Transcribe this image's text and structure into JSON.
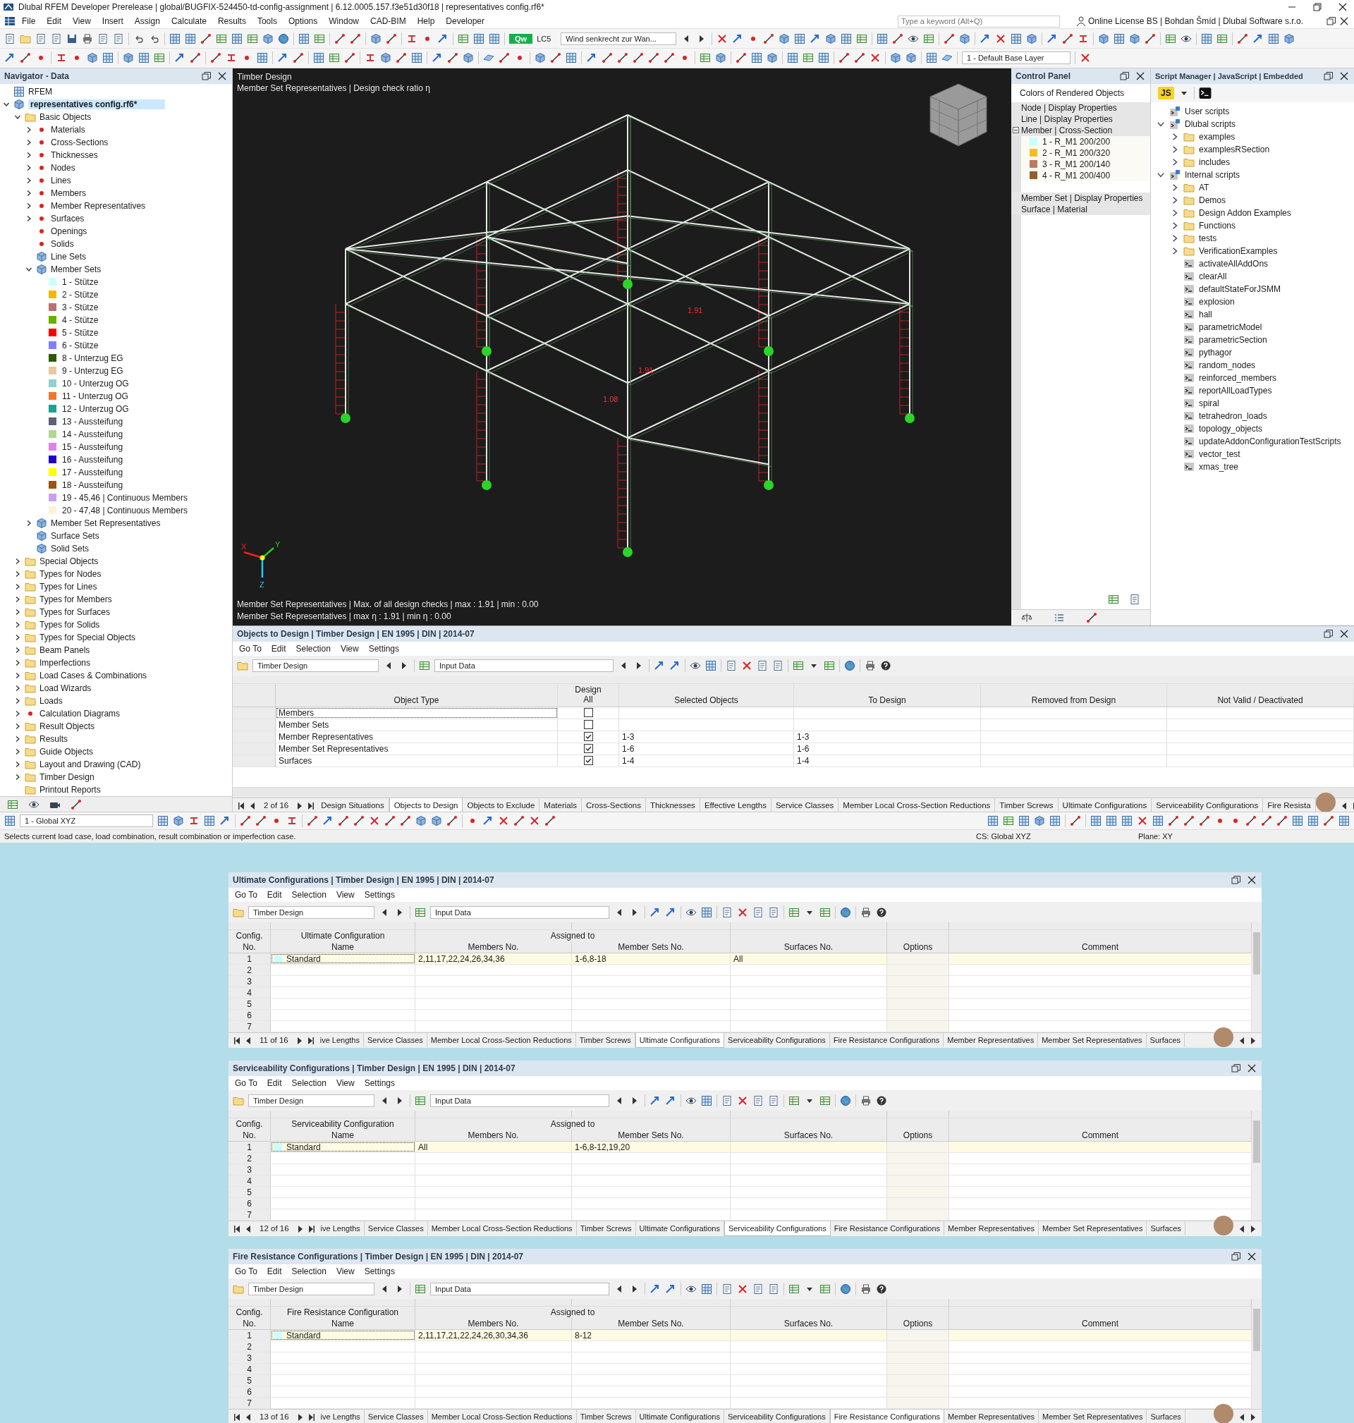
{
  "window": {
    "title": "Dlubal RFEM Developer Prerelease | global/BUGFIX-524450-td-config-assignment | 6.12.0005.157.f3e51d30f18 | representatives config.rf6*"
  },
  "menu": [
    "File",
    "Edit",
    "View",
    "Insert",
    "Assign",
    "Calculate",
    "Results",
    "Tools",
    "Options",
    "Window",
    "CAD-BIM",
    "Help",
    "Developer"
  ],
  "search": {
    "placeholder": "Type a keyword (Alt+Q)"
  },
  "license": "Online License BS | Bohdan Šmíd | Dlubal Software s.r.o.",
  "toolbar": {
    "load_badge": "Qw",
    "load_case": "LC5",
    "load_case_name": "Wind senkrecht zur Wan...",
    "layer": "1 - Default Base Layer"
  },
  "navigator": {
    "title": "Navigator - Data",
    "tree": [
      {
        "label": "RFEM",
        "kind": "root",
        "selected": false
      },
      {
        "label": "representatives config.rf6*",
        "kind": "file",
        "expanded": true,
        "selected": true,
        "children": [
          {
            "label": "Basic Objects",
            "kind": "folder",
            "expanded": true,
            "selected": false,
            "children": [
              {
                "label": "Materials",
                "kind": "object",
                "expanded": false,
                "selected": false
              },
              {
                "label": "Cross-Sections",
                "kind": "object",
                "expanded": false,
                "selected": false
              },
              {
                "label": "Thicknesses",
                "kind": "object",
                "expanded": false,
                "selected": false
              },
              {
                "label": "Nodes",
                "kind": "object",
                "expanded": false,
                "selected": false
              },
              {
                "label": "Lines",
                "kind": "object",
                "expanded": false,
                "selected": false
              },
              {
                "label": "Members",
                "kind": "object",
                "expanded": false,
                "selected": false
              },
              {
                "label": "Member Representatives",
                "kind": "object",
                "expanded": false,
                "selected": false
              },
              {
                "label": "Surfaces",
                "kind": "object",
                "expanded": false,
                "selected": false
              },
              {
                "label": "Openings",
                "kind": "object",
                "selected": false
              },
              {
                "label": "Solids",
                "kind": "object",
                "selected": false
              },
              {
                "label": "Line Sets",
                "kind": "object",
                "selected": false
              },
              {
                "label": "Member Sets",
                "kind": "object",
                "expanded": true,
                "selected": false,
                "children": [
                  {
                    "label": "1 - Stütze",
                    "kind": "set",
                    "color": "#ccffff",
                    "selected": false
                  },
                  {
                    "label": "2 - Stütze",
                    "kind": "set",
                    "color": "#f5b800",
                    "selected": false
                  },
                  {
                    "label": "3 - Stütze",
                    "kind": "set",
                    "color": "#b87070",
                    "selected": false
                  },
                  {
                    "label": "4 - Stütze",
                    "kind": "set",
                    "color": "#6ab000",
                    "selected": false
                  },
                  {
                    "label": "5 - Stütze",
                    "kind": "set",
                    "color": "#ff0000",
                    "selected": false
                  },
                  {
                    "label": "6 - Stütze",
                    "kind": "set",
                    "color": "#8080ff",
                    "selected": false
                  },
                  {
                    "label": "8 - Unterzug EG",
                    "kind": "set",
                    "color": "#2d5a00",
                    "selected": false
                  },
                  {
                    "label": "9 - Unterzug EG",
                    "kind": "set",
                    "color": "#e8c8a0",
                    "selected": false
                  },
                  {
                    "label": "10 - Unterzug OG",
                    "kind": "set",
                    "color": "#90d0d0",
                    "selected": false
                  },
                  {
                    "label": "11 - Unterzug OG",
                    "kind": "set",
                    "color": "#f07830",
                    "selected": false
                  },
                  {
                    "label": "12 - Unterzug OG",
                    "kind": "set",
                    "color": "#20a090",
                    "selected": false
                  },
                  {
                    "label": "13 - Aussteifung",
                    "kind": "set",
                    "color": "#606070",
                    "selected": false
                  },
                  {
                    "label": "14 - Aussteifung",
                    "kind": "set",
                    "color": "#b0d890",
                    "selected": false
                  },
                  {
                    "label": "15 - Aussteifung",
                    "kind": "set",
                    "color": "#e080f0",
                    "selected": false
                  },
                  {
                    "label": "16 - Aussteifung",
                    "kind": "set",
                    "color": "#2000c0",
                    "selected": false
                  },
                  {
                    "label": "17 - Aussteifung",
                    "kind": "set",
                    "color": "#ffff00",
                    "selected": false
                  },
                  {
                    "label": "18 - Aussteifung",
                    "kind": "set",
                    "color": "#a05010",
                    "selected": false
                  },
                  {
                    "label": "19 - 45,46 | Continuous Members",
                    "kind": "set",
                    "color": "#c8a0f0",
                    "selected": false
                  },
                  {
                    "label": "20 - 47,48 | Continuous Members",
                    "kind": "set",
                    "color": "#fff0d8",
                    "selected": false
                  }
                ]
              },
              {
                "label": "Member Set Representatives",
                "kind": "object",
                "expanded": false,
                "selected": false
              },
              {
                "label": "Surface Sets",
                "kind": "object",
                "selected": false
              },
              {
                "label": "Solid Sets",
                "kind": "object",
                "selected": false
              }
            ]
          },
          {
            "label": "Special Objects",
            "kind": "folder",
            "expanded": false,
            "selected": false
          },
          {
            "label": "Types for Nodes",
            "kind": "folder",
            "expanded": false,
            "selected": false
          },
          {
            "label": "Types for Lines",
            "kind": "folder",
            "expanded": false,
            "selected": false
          },
          {
            "label": "Types for Members",
            "kind": "folder",
            "expanded": false,
            "selected": false
          },
          {
            "label": "Types for Surfaces",
            "kind": "folder",
            "expanded": false,
            "selected": false
          },
          {
            "label": "Types for Solids",
            "kind": "folder",
            "expanded": false,
            "selected": false
          },
          {
            "label": "Types for Special Objects",
            "kind": "folder",
            "expanded": false,
            "selected": false
          },
          {
            "label": "Beam Panels",
            "kind": "folder",
            "expanded": false,
            "selected": false
          },
          {
            "label": "Imperfections",
            "kind": "folder",
            "expanded": false,
            "selected": false
          },
          {
            "label": "Load Cases & Combinations",
            "kind": "folder",
            "expanded": false,
            "selected": false
          },
          {
            "label": "Load Wizards",
            "kind": "folder",
            "expanded": false,
            "selected": false
          },
          {
            "label": "Loads",
            "kind": "folder",
            "expanded": false,
            "selected": false
          },
          {
            "label": "Calculation Diagrams",
            "kind": "object",
            "expanded": false,
            "selected": false
          },
          {
            "label": "Result Objects",
            "kind": "folder",
            "expanded": false,
            "selected": false
          },
          {
            "label": "Results",
            "kind": "folder",
            "expanded": false,
            "selected": false
          },
          {
            "label": "Guide Objects",
            "kind": "folder",
            "expanded": false,
            "selected": false
          },
          {
            "label": "Layout and Drawing (CAD)",
            "kind": "folder",
            "expanded": false,
            "selected": false
          },
          {
            "label": "Timber Design",
            "kind": "folder",
            "expanded": false,
            "selected": false
          },
          {
            "label": "Printout Reports",
            "kind": "folder",
            "selected": false
          }
        ]
      }
    ]
  },
  "viewport": {
    "title": "Timber Design",
    "subtitle": "Member Set Representatives | Design check ratio η",
    "labels": [
      "1.91",
      "1.91",
      "1.08"
    ],
    "axes": [
      "X",
      "Y",
      "Z"
    ],
    "footer": [
      "Member Set Representatives | Max. of all design checks | max  : 1.91 | min  : 0.00",
      "Member Set Representatives | max η : 1.91 | min η : 0.00"
    ]
  },
  "control_panel": {
    "title": "Control Panel",
    "heading": "Colors of Rendered Objects",
    "groups": [
      {
        "label": "Node | Display Properties"
      },
      {
        "label": "Line | Display Properties"
      },
      {
        "label": "Member | Cross-Section",
        "expanded": true,
        "items": [
          {
            "label": "1 - R_M1 200/200",
            "color": "#c8ffff"
          },
          {
            "label": "2 - R_M1 200/320",
            "color": "#f0c020"
          },
          {
            "label": "3 - R_M1 200/140",
            "color": "#c07860"
          },
          {
            "label": "4 - R_M1 200/400",
            "color": "#906030"
          }
        ]
      },
      {
        "label": "Member Set | Display Properties"
      },
      {
        "label": "Surface | Material"
      }
    ]
  },
  "script_manager": {
    "title": "Script Manager | JavaScript | Embedded",
    "language": "JS",
    "tree": [
      {
        "label": "User scripts",
        "kind": "root"
      },
      {
        "label": "Dlubal scripts",
        "kind": "root",
        "expanded": true,
        "children": [
          {
            "label": "examples",
            "kind": "folder",
            "expanded": false
          },
          {
            "label": "examplesRSection",
            "kind": "folder",
            "expanded": false
          },
          {
            "label": "includes",
            "kind": "folder",
            "expanded": false
          }
        ]
      },
      {
        "label": "Internal scripts",
        "kind": "root",
        "expanded": true,
        "children": [
          {
            "label": "AT",
            "kind": "folder",
            "expanded": false
          },
          {
            "label": "Demos",
            "kind": "folder",
            "expanded": false
          },
          {
            "label": "Design Addon Examples",
            "kind": "folder",
            "expanded": false
          },
          {
            "label": "Functions",
            "kind": "folder",
            "expanded": false
          },
          {
            "label": "tests",
            "kind": "folder",
            "expanded": false
          },
          {
            "label": "VerificationExamples",
            "kind": "folder",
            "expanded": false
          },
          {
            "label": "activateAllAddOns",
            "kind": "script"
          },
          {
            "label": "clearAll",
            "kind": "script"
          },
          {
            "label": "defaultStateForJSMM",
            "kind": "script"
          },
          {
            "label": "explosion",
            "kind": "script"
          },
          {
            "label": "hall",
            "kind": "script"
          },
          {
            "label": "parametricModel",
            "kind": "script"
          },
          {
            "label": "parametricSection",
            "kind": "script"
          },
          {
            "label": "pythagor",
            "kind": "script"
          },
          {
            "label": "random_nodes",
            "kind": "script"
          },
          {
            "label": "reinforced_members",
            "kind": "script"
          },
          {
            "label": "reportAllLoadTypes",
            "kind": "script"
          },
          {
            "label": "spiral",
            "kind": "script"
          },
          {
            "label": "tetrahedron_loads",
            "kind": "script"
          },
          {
            "label": "topology_objects",
            "kind": "script"
          },
          {
            "label": "updateAddonConfigurationTestScripts",
            "kind": "script"
          },
          {
            "label": "vector_test",
            "kind": "script"
          },
          {
            "label": "xmas_tree",
            "kind": "script"
          }
        ]
      }
    ]
  },
  "objects_panel": {
    "title": "Objects to Design | Timber Design | EN 1995 | DIN | 2014-07",
    "menu": [
      "Go To",
      "Edit",
      "Selection",
      "View",
      "Settings"
    ],
    "module": "Timber Design",
    "data_view": "Input Data",
    "columns": [
      "Object Type",
      "Design",
      "All",
      "Selected Objects",
      "To Design",
      "Removed from Design",
      "Not Valid / Deactivated"
    ],
    "rows": [
      {
        "object_type": "Members",
        "design": false,
        "selected": true
      },
      {
        "object_type": "Member Sets",
        "design": false,
        "selected": false
      },
      {
        "object_type": "Member Representatives",
        "design": true,
        "selected_objects": "1-3",
        "to_design": "1-3",
        "selected": false
      },
      {
        "object_type": "Member Set Representatives",
        "design": true,
        "selected_objects": "1-6",
        "to_design": "1-6",
        "selected": false
      },
      {
        "object_type": "Surfaces",
        "design": true,
        "selected_objects": "1-4",
        "to_design": "1-4",
        "selected": false
      }
    ],
    "page": "2 of 16",
    "tabs": [
      {
        "label": "Design Situations",
        "selected": false
      },
      {
        "label": "Objects to Design",
        "selected": true
      },
      {
        "label": "Objects to Exclude",
        "selected": false
      },
      {
        "label": "Materials",
        "selected": false
      },
      {
        "label": "Cross-Sections",
        "selected": false
      },
      {
        "label": "Thicknesses",
        "selected": false
      },
      {
        "label": "Effective Lengths",
        "selected": false
      },
      {
        "label": "Service Classes",
        "selected": false
      },
      {
        "label": "Member Local Cross-Section Reductions",
        "selected": false
      },
      {
        "label": "Timber Screws",
        "selected": false
      },
      {
        "label": "Ultimate Configurations",
        "selected": false
      },
      {
        "label": "Serviceability Configurations",
        "selected": false
      },
      {
        "label": "Fire Resista",
        "selected": false
      }
    ]
  },
  "bottom_toolbar": {
    "coord_system": "1 - Global XYZ"
  },
  "status_bar": {
    "hint": "Selects current load case, load combination, result combination or imperfection case.",
    "cs": "CS: Global XYZ",
    "plane": "Plane: XY"
  },
  "config_panels": [
    {
      "title": "Ultimate Configurations | Timber Design | EN 1995 | DIN | 2014-07",
      "menu": [
        "Go To",
        "Edit",
        "Selection",
        "View",
        "Settings"
      ],
      "module": "Timber Design",
      "data_view": "Input Data",
      "group_header": "Assigned to",
      "columns": [
        {
          "top": "Config.",
          "bottom": "No."
        },
        {
          "top": "Ultimate Configuration",
          "bottom": "Name"
        },
        {
          "bottom": "Members No."
        },
        {
          "bottom": "Member Sets No."
        },
        {
          "bottom": "Surfaces No."
        },
        {
          "bottom": "Options"
        },
        {
          "bottom": "Comment"
        }
      ],
      "rows": [
        {
          "no": "1",
          "name": "Standard",
          "members": "2,11,17,22,24,26,34,36",
          "member_sets": "1-6,8-18",
          "surfaces": "All",
          "selected": true
        },
        {
          "no": "2",
          "selected": false
        },
        {
          "no": "3",
          "selected": false
        },
        {
          "no": "4",
          "selected": false
        },
        {
          "no": "5",
          "selected": false
        },
        {
          "no": "6",
          "selected": false
        },
        {
          "no": "7",
          "selected": false
        }
      ],
      "page": "11 of 16",
      "tabs": [
        {
          "label": "ive Lengths",
          "selected": false
        },
        {
          "label": "Service Classes",
          "selected": false
        },
        {
          "label": "Member Local Cross-Section Reductions",
          "selected": false
        },
        {
          "label": "Timber Screws",
          "selected": false
        },
        {
          "label": "Ultimate Configurations",
          "selected": true
        },
        {
          "label": "Serviceability Configurations",
          "selected": false
        },
        {
          "label": "Fire Resistance Configurations",
          "selected": false
        },
        {
          "label": "Member Representatives",
          "selected": false
        },
        {
          "label": "Member Set Representatives",
          "selected": false
        },
        {
          "label": "Surfaces",
          "selected": false
        }
      ]
    },
    {
      "title": "Serviceability Configurations | Timber Design | EN 1995 | DIN | 2014-07",
      "menu": [
        "Go To",
        "Edit",
        "Selection",
        "View",
        "Settings"
      ],
      "module": "Timber Design",
      "data_view": "Input Data",
      "group_header": "Assigned to",
      "columns": [
        {
          "top": "Config.",
          "bottom": "No."
        },
        {
          "top": "Serviceability Configuration",
          "bottom": "Name"
        },
        {
          "bottom": "Members No."
        },
        {
          "bottom": "Member Sets No."
        },
        {
          "bottom": "Surfaces No."
        },
        {
          "bottom": "Options"
        },
        {
          "bottom": "Comment"
        }
      ],
      "rows": [
        {
          "no": "1",
          "name": "Standard",
          "members": "All",
          "member_sets": "1-6,8-12,19,20",
          "selected": true
        },
        {
          "no": "2",
          "selected": false
        },
        {
          "no": "3",
          "selected": false
        },
        {
          "no": "4",
          "selected": false
        },
        {
          "no": "5",
          "selected": false
        },
        {
          "no": "6",
          "selected": false
        },
        {
          "no": "7",
          "selected": false
        }
      ],
      "page": "12 of 16",
      "tabs": [
        {
          "label": "ive Lengths",
          "selected": false
        },
        {
          "label": "Service Classes",
          "selected": false
        },
        {
          "label": "Member Local Cross-Section Reductions",
          "selected": false
        },
        {
          "label": "Timber Screws",
          "selected": false
        },
        {
          "label": "Ultimate Configurations",
          "selected": false
        },
        {
          "label": "Serviceability Configurations",
          "selected": true
        },
        {
          "label": "Fire Resistance Configurations",
          "selected": false
        },
        {
          "label": "Member Representatives",
          "selected": false
        },
        {
          "label": "Member Set Representatives",
          "selected": false
        },
        {
          "label": "Surfaces",
          "selected": false
        }
      ]
    },
    {
      "title": "Fire Resistance Configurations | Timber Design | EN 1995 | DIN | 2014-07",
      "menu": [
        "Go To",
        "Edit",
        "Selection",
        "View",
        "Settings"
      ],
      "module": "Timber Design",
      "data_view": "Input Data",
      "group_header": "Assigned to",
      "columns": [
        {
          "top": "Config.",
          "bottom": "No."
        },
        {
          "top": "Fire Resistance Configuration",
          "bottom": "Name"
        },
        {
          "bottom": "Members No."
        },
        {
          "bottom": "Member Sets No."
        },
        {
          "bottom": "Surfaces No."
        },
        {
          "bottom": "Options"
        },
        {
          "bottom": "Comment"
        }
      ],
      "rows": [
        {
          "no": "1",
          "name": "Standard",
          "members": "2,11,17,21,22,24,26,30,34,36",
          "member_sets": "8-12",
          "selected": true
        },
        {
          "no": "2",
          "selected": false
        },
        {
          "no": "3",
          "selected": false
        },
        {
          "no": "4",
          "selected": false
        },
        {
          "no": "5",
          "selected": false
        },
        {
          "no": "6",
          "selected": false
        },
        {
          "no": "7",
          "selected": false
        }
      ],
      "page": "13 of 16",
      "tabs": [
        {
          "label": "ive Lengths",
          "selected": false
        },
        {
          "label": "Service Classes",
          "selected": false
        },
        {
          "label": "Member Local Cross-Section Reductions",
          "selected": false
        },
        {
          "label": "Timber Screws",
          "selected": false
        },
        {
          "label": "Ultimate Configurations",
          "selected": false
        },
        {
          "label": "Serviceability Configurations",
          "selected": false
        },
        {
          "label": "Fire Resistance Configurations",
          "selected": true
        },
        {
          "label": "Member Representatives",
          "selected": false
        },
        {
          "label": "Member Set Representatives",
          "selected": false
        },
        {
          "label": "Surfaces",
          "selected": false
        }
      ]
    }
  ]
}
